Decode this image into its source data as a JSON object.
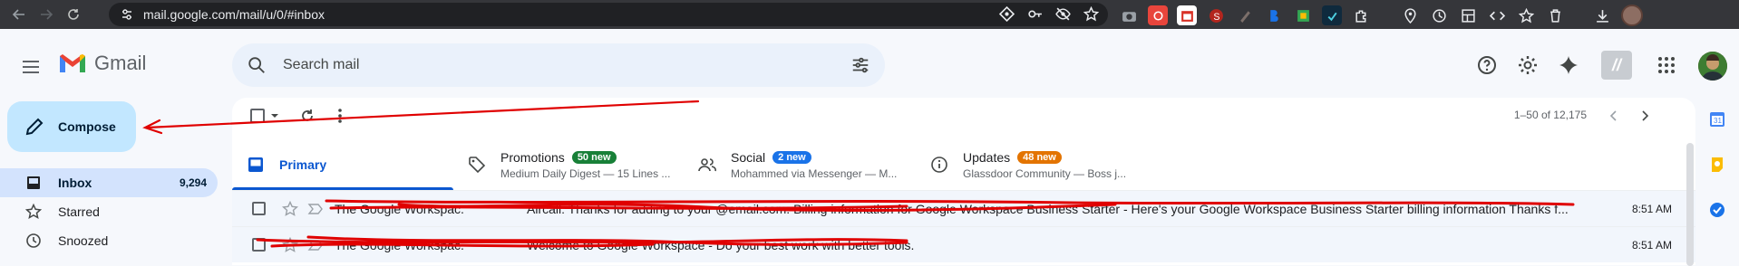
{
  "browser": {
    "url": "mail.google.com/mail/u/0/#inbox"
  },
  "app": {
    "name": "Gmail"
  },
  "search": {
    "placeholder": "Search mail"
  },
  "compose": {
    "label": "Compose"
  },
  "sidebar": {
    "items": [
      {
        "label": "Inbox",
        "count": "9,294",
        "icon": "inbox-icon",
        "active": true
      },
      {
        "label": "Starred",
        "count": "",
        "icon": "star-icon",
        "active": false
      },
      {
        "label": "Snoozed",
        "count": "",
        "icon": "clock-icon",
        "active": false
      }
    ]
  },
  "toolbar": {
    "pager": "1–50 of 12,175"
  },
  "tabs": [
    {
      "label": "Primary",
      "badge": "",
      "sub": "",
      "icon": "inbox-tab-icon",
      "active": true
    },
    {
      "label": "Promotions",
      "badge": "50 new",
      "badge_color": "#188038",
      "sub": "Medium Daily Digest — 15 Lines ...",
      "icon": "tag-icon"
    },
    {
      "label": "Social",
      "badge": "2 new",
      "badge_color": "#1a73e8",
      "sub": "Mohammed via Messenger — M...",
      "icon": "people-icon"
    },
    {
      "label": "Updates",
      "badge": "48 new",
      "badge_color": "#e37400",
      "sub": "Glassdoor Community — Boss j...",
      "icon": "info-icon"
    }
  ],
  "emails": [
    {
      "sender": "The Google Workspac.",
      "subject": "Aircall: Thanks for adding to your @email.com. Billing information for Google Workspace Business Starter - Here's your Google Workspace Business Starter billing information Thanks f...",
      "time": "8:51 AM"
    },
    {
      "sender": "The Google Workspac.",
      "subject": "Welcome to Google Workspace - Do your best work with better tools.",
      "time": "8:51 AM"
    }
  ],
  "colors": {
    "accent": "#0b57d0",
    "compose_bg": "#c2e7ff",
    "annotation": "#e00000"
  }
}
